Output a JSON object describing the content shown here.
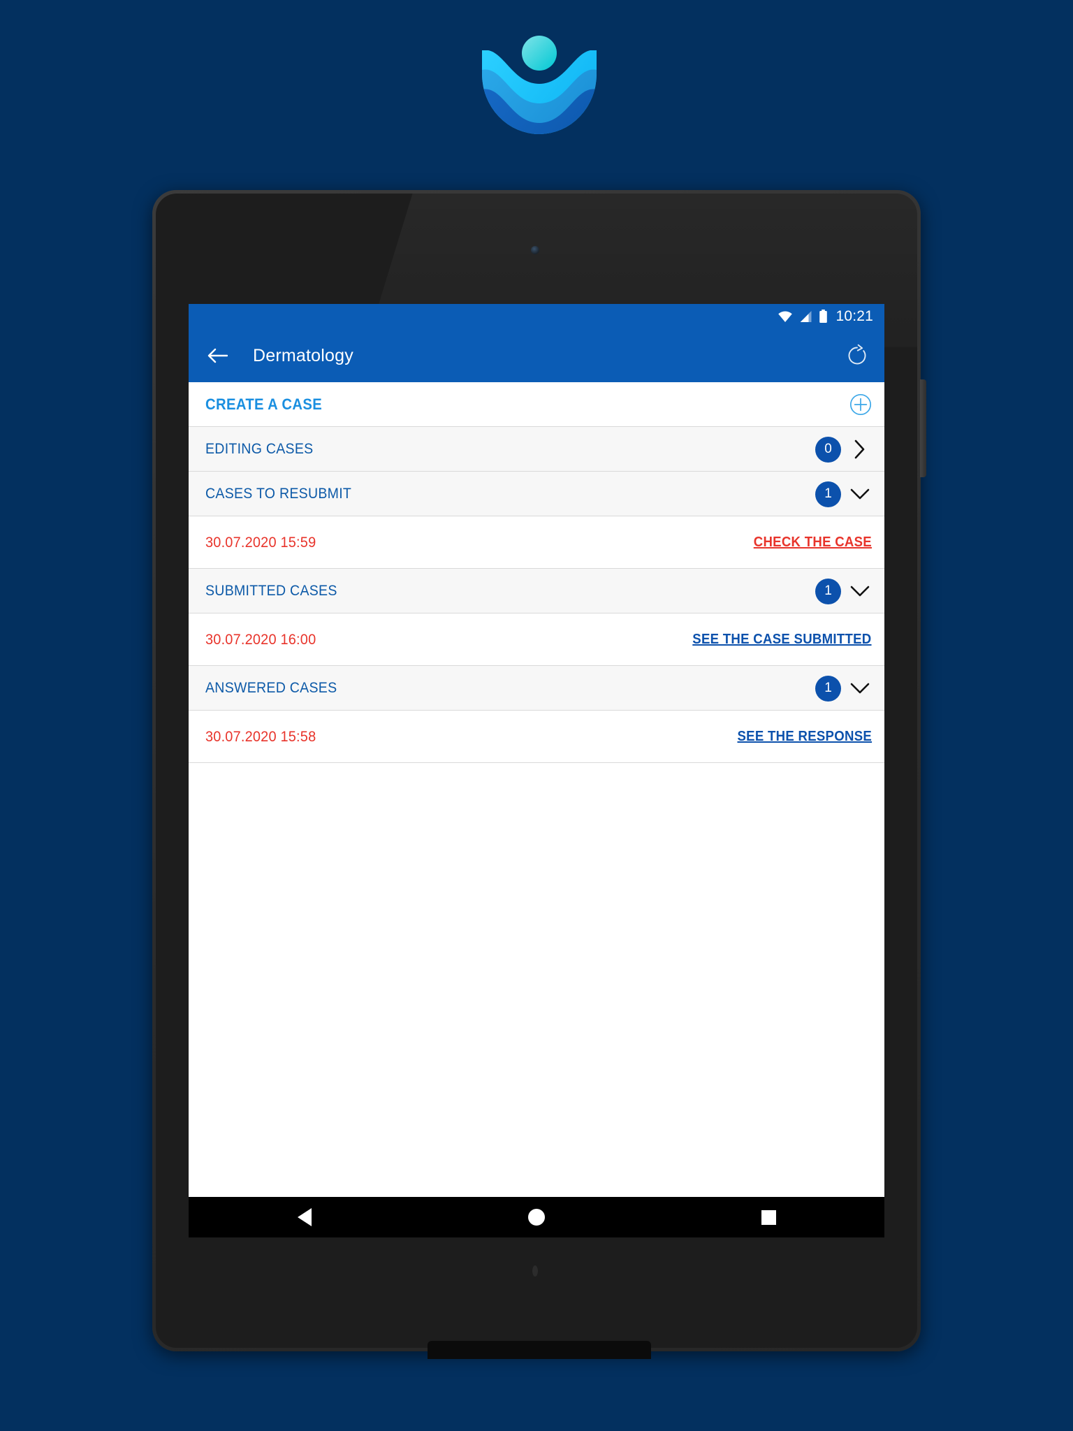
{
  "brand": {
    "logo_icon": "wave-person-logo",
    "colors": {
      "background": "#03305f",
      "primary": "#0b5cb5",
      "badge": "#0c51ac",
      "accent_light_blue": "#1a8fe0",
      "alert_red": "#e8342b"
    }
  },
  "device": {
    "type": "android-tablet",
    "camera_icon": "front-camera",
    "side_button_icon": "power-button"
  },
  "status_bar": {
    "wifi_icon": "wifi-icon",
    "signal_icon": "cell-signal-icon",
    "battery_icon": "battery-full-icon",
    "clock": "10:21"
  },
  "app_bar": {
    "back_icon": "arrow-left-icon",
    "title": "Dermatology",
    "refresh_icon": "refresh-icon"
  },
  "create_case": {
    "label": "CREATE A CASE",
    "add_icon": "plus-circle-icon"
  },
  "sections": [
    {
      "label": "EDITING CASES",
      "count": "0",
      "expanded": false,
      "chevron_icon": "chevron-right-icon",
      "cases": []
    },
    {
      "label": "CASES TO RESUBMIT",
      "count": "1",
      "expanded": true,
      "chevron_icon": "chevron-down-icon",
      "cases": [
        {
          "date": "30.07.2020 15:59",
          "action": "CHECK THE CASE",
          "action_color": "red"
        }
      ]
    },
    {
      "label": "SUBMITTED CASES",
      "count": "1",
      "expanded": true,
      "chevron_icon": "chevron-down-icon",
      "cases": [
        {
          "date": "30.07.2020 16:00",
          "action": "SEE THE CASE SUBMITTED",
          "action_color": "blue"
        }
      ]
    },
    {
      "label": "ANSWERED CASES",
      "count": "1",
      "expanded": true,
      "chevron_icon": "chevron-down-icon",
      "cases": [
        {
          "date": "30.07.2020 15:58",
          "action": "SEE THE RESPONSE",
          "action_color": "blue"
        }
      ]
    }
  ],
  "nav_bar": {
    "back_icon": "nav-back-triangle-icon",
    "home_icon": "nav-home-circle-icon",
    "recents_icon": "nav-recents-square-icon"
  }
}
